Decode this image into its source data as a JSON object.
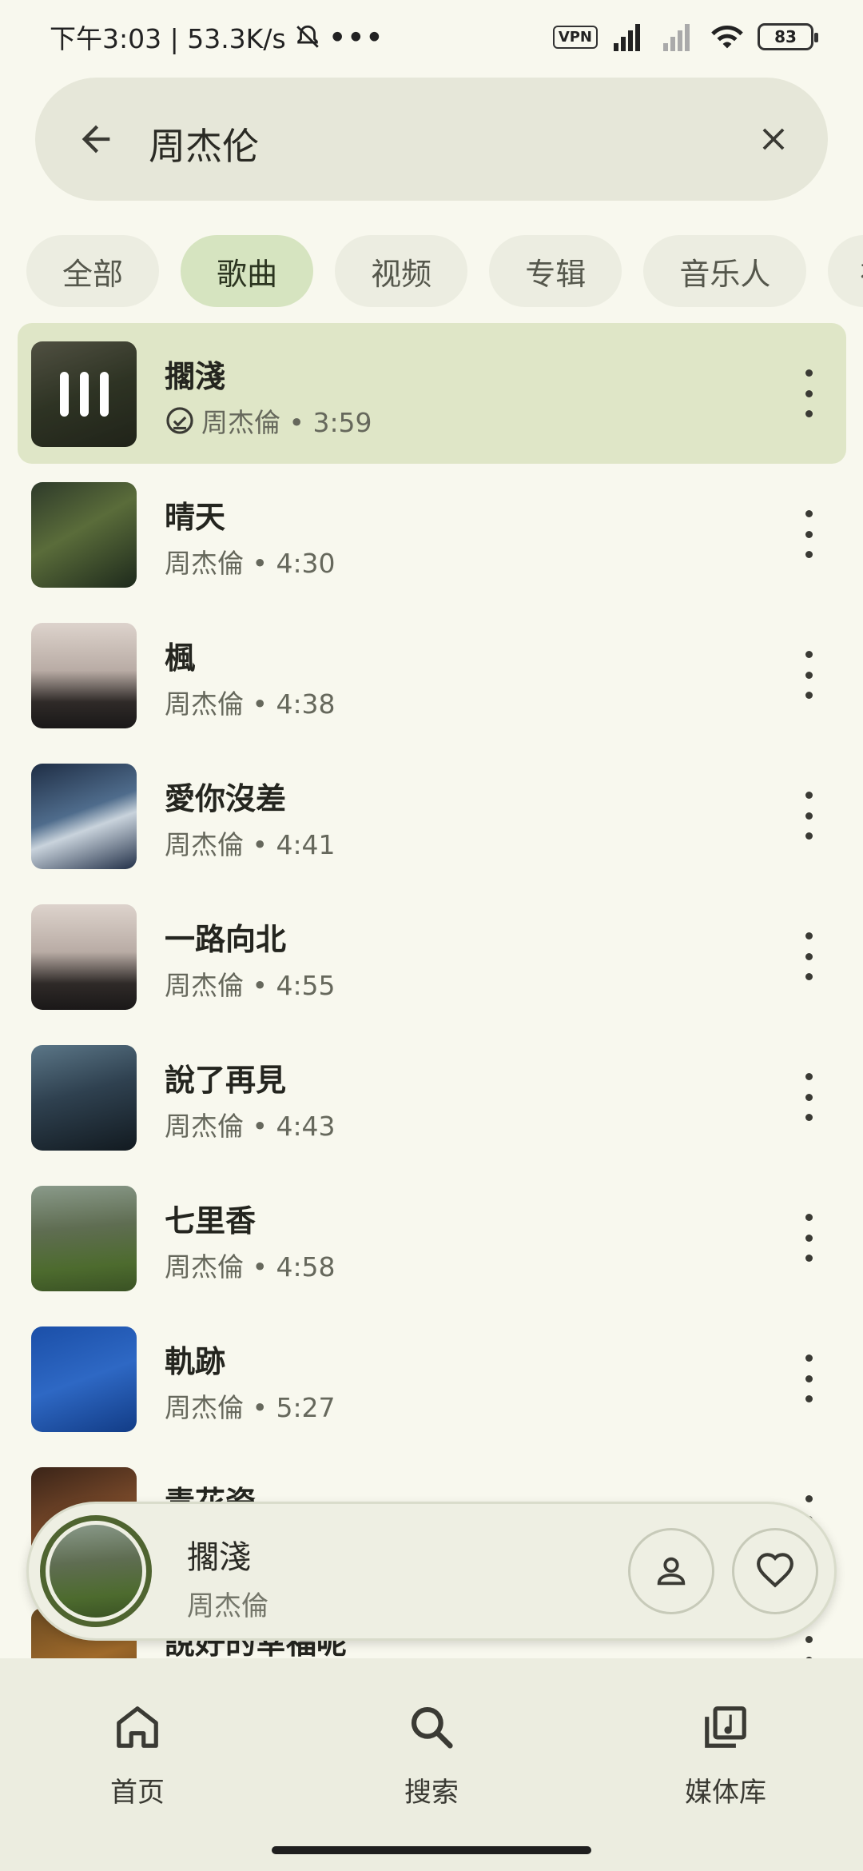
{
  "status_bar": {
    "time_speed": "下午3:03 | 53.3K/s",
    "vpn": "VPN",
    "battery": "83"
  },
  "search": {
    "query": "周杰伦"
  },
  "chips": [
    {
      "label": "全部",
      "active": false
    },
    {
      "label": "歌曲",
      "active": true
    },
    {
      "label": "视频",
      "active": false
    },
    {
      "label": "专辑",
      "active": false
    },
    {
      "label": "音乐人",
      "active": false
    },
    {
      "label": "社",
      "active": false
    }
  ],
  "songs": [
    {
      "title": "擱淺",
      "subtitle": "周杰倫 • 3:59",
      "playing": true
    },
    {
      "title": "晴天",
      "subtitle": "周杰倫 • 4:30"
    },
    {
      "title": "楓",
      "subtitle": "周杰倫 • 4:38"
    },
    {
      "title": "愛你沒差",
      "subtitle": "周杰倫 • 4:41"
    },
    {
      "title": "一路向北",
      "subtitle": "周杰倫 • 4:55"
    },
    {
      "title": "說了再見",
      "subtitle": "周杰倫 • 4:43"
    },
    {
      "title": "七里香",
      "subtitle": "周杰倫 • 4:58"
    },
    {
      "title": "軌跡",
      "subtitle": "周杰倫 • 5:27"
    },
    {
      "title": "青花瓷",
      "subtitle": ""
    },
    {
      "title": "說好的幸福呢",
      "subtitle": ""
    }
  ],
  "mini_player": {
    "title": "擱淺",
    "artist": "周杰倫"
  },
  "nav": [
    {
      "label": "首页",
      "icon": "home-icon"
    },
    {
      "label": "搜索",
      "icon": "search-icon"
    },
    {
      "label": "媒体库",
      "icon": "library-icon"
    }
  ],
  "colors": {
    "background": "#f8f8ee",
    "accent": "#4f6430",
    "selected_row": "#dfe6c7",
    "selected_chip": "#d6e4c0"
  }
}
